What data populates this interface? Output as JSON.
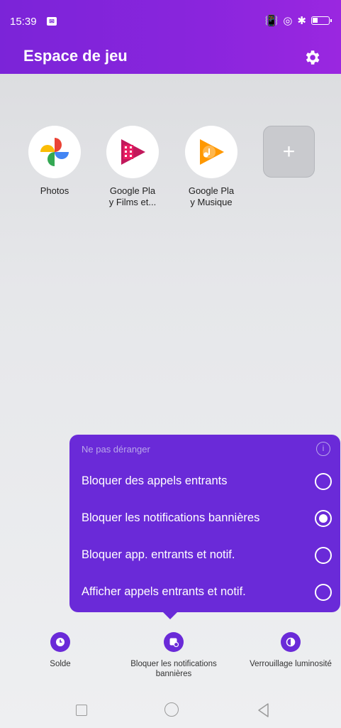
{
  "status_bar": {
    "time": "15:39"
  },
  "header": {
    "title": "Espace de jeu"
  },
  "apps": [
    {
      "label": "Photos"
    },
    {
      "label": "Google Pla\ny Films et..."
    },
    {
      "label": "Google Pla\ny Musique"
    }
  ],
  "add_tile": {
    "symbol": "+"
  },
  "popup": {
    "title": "Ne pas déranger",
    "info_symbol": "i",
    "options": [
      {
        "label": "Bloquer des appels entrants",
        "selected": false
      },
      {
        "label": "Bloquer les notifications bannières",
        "selected": true
      },
      {
        "label": "Bloquer app. entrants et notif.",
        "selected": false
      },
      {
        "label": "Afficher appels entrants et notif.",
        "selected": false
      }
    ]
  },
  "tools": [
    {
      "label": "Solde"
    },
    {
      "label": "Bloquer les notifications\nbannières"
    },
    {
      "label": "Verrouillage luminosité"
    }
  ],
  "colors": {
    "header_purple": "#8a25dd",
    "popup_purple": "#6a2ad8"
  }
}
